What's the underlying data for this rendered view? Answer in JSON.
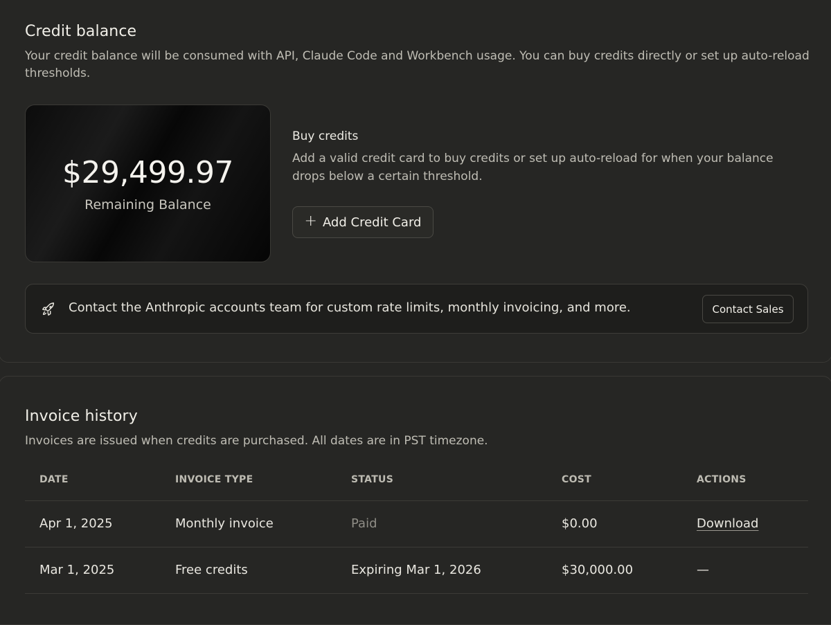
{
  "credit": {
    "title": "Credit balance",
    "description_line1": "Your credit balance will be consumed with API, Claude Code and Workbench usage. You can buy credits directly or set up auto-reload",
    "description_line2": "thresholds.",
    "balance_amount": "$29,499.97",
    "balance_label": "Remaining Balance",
    "buy_title": "Buy credits",
    "buy_description": "Add a valid credit card to buy credits or set up auto-reload for when your balance drops below a certain threshold.",
    "add_card_label": "Add Credit Card",
    "contact_text": "Contact the Anthropic accounts team for custom rate limits, monthly invoicing, and more.",
    "contact_button": "Contact Sales"
  },
  "invoices": {
    "title": "Invoice history",
    "description": "Invoices are issued when credits are purchased. All dates are in PST timezone.",
    "columns": [
      "DATE",
      "INVOICE TYPE",
      "STATUS",
      "COST",
      "ACTIONS"
    ],
    "rows": [
      {
        "date": "Apr 1, 2025",
        "type": "Monthly invoice",
        "status": "Paid",
        "cost": "$0.00",
        "action": "Download"
      },
      {
        "date": "Mar 1, 2025",
        "type": "Free credits",
        "status": "Expiring Mar 1, 2026",
        "cost": "$30,000.00",
        "action": "—"
      }
    ]
  },
  "icons": {
    "add": "plus-icon",
    "contact": "rocket-icon"
  }
}
